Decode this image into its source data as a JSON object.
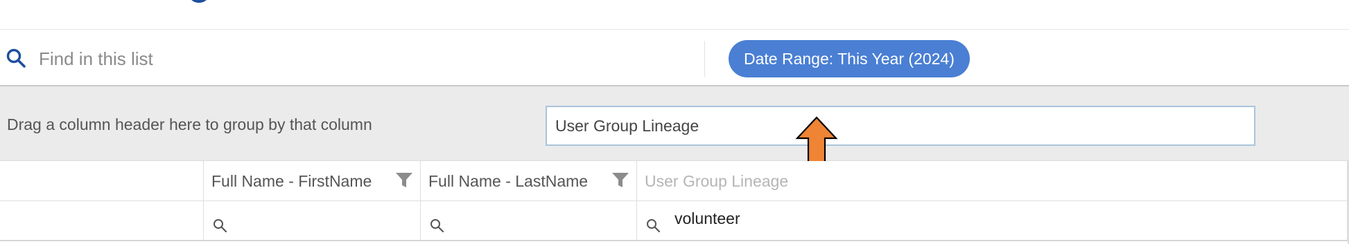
{
  "colors": {
    "accent": "#1e4f9c",
    "chip_bg": "#4a7fd4",
    "chip_text": "#ffffff",
    "group_panel_bg": "#ebebeb",
    "arrow_fill": "#ef8434",
    "arrow_stroke": "#000000"
  },
  "icons": {
    "toolbar_search": "search-icon",
    "column_filter": "funnel-icon",
    "cell_search": "search-icon",
    "annotation": "up-arrow"
  },
  "toolbar": {
    "search_placeholder": "Find in this list",
    "date_range_chip": "Date Range: This Year (2024)"
  },
  "group_panel": {
    "hint": "Drag a column header here to group by that column",
    "dragged_column": "User Group Lineage"
  },
  "grid": {
    "columns": [
      {
        "label": ""
      },
      {
        "label": "Full Name - FirstName"
      },
      {
        "label": "Full Name - LastName"
      },
      {
        "label": "User Group Lineage"
      }
    ],
    "filters": [
      "",
      "",
      "",
      "volunteer"
    ]
  }
}
